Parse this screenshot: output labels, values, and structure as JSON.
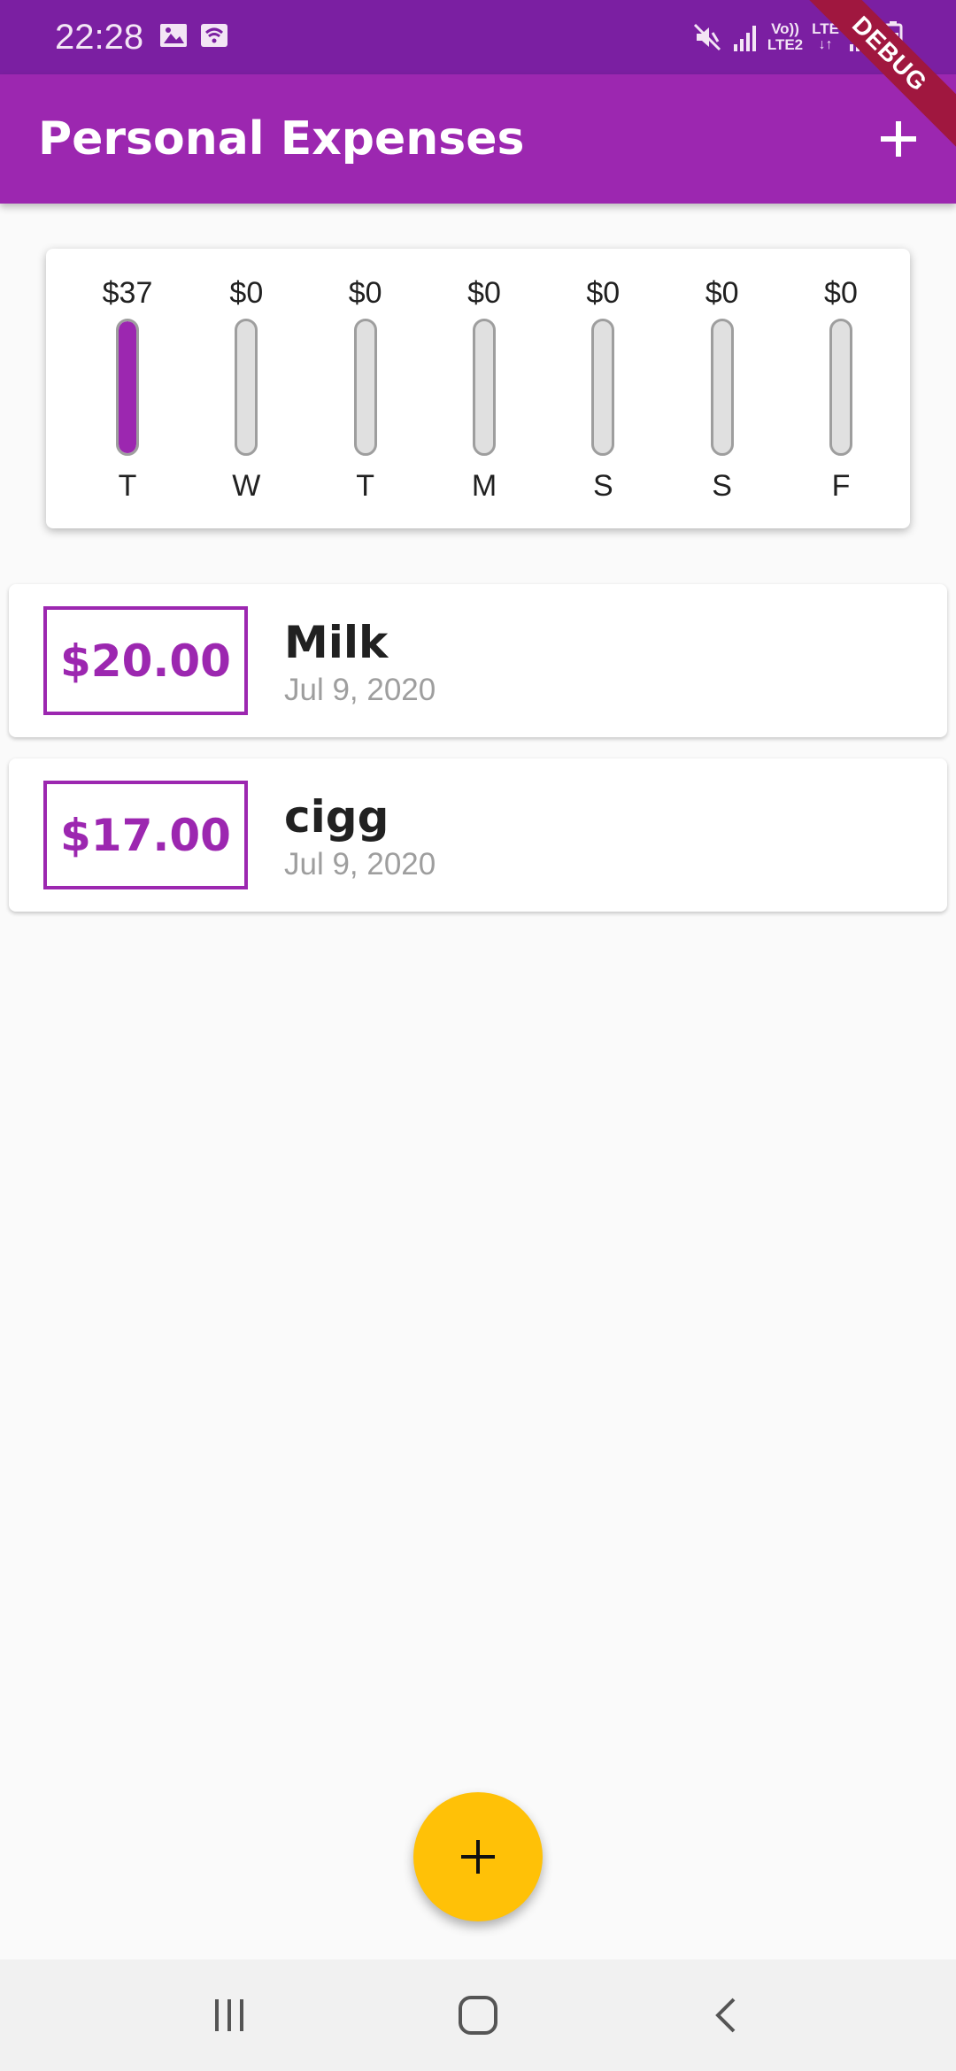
{
  "status_bar": {
    "time": "22:28",
    "icons_left": [
      "image-icon",
      "wifi-icon"
    ],
    "icons_right": [
      "mute-icon",
      "signal-icon",
      "volte-icon",
      "lte-icon",
      "signal-icon",
      "battery-icon"
    ],
    "volte_line1": "Vo))",
    "volte_line2": "LTE2",
    "lte_label": "LTE"
  },
  "debug_banner": "DEBUG",
  "app_bar": {
    "title": "Personal Expenses",
    "add_icon": "plus-icon"
  },
  "chart": {
    "colors": {
      "fill": "#9c27b0",
      "empty": "#e0e0e0"
    },
    "days": [
      {
        "day": "T",
        "amount": "$37",
        "fill_fraction": 1.0
      },
      {
        "day": "W",
        "amount": "$0",
        "fill_fraction": 0
      },
      {
        "day": "T",
        "amount": "$0",
        "fill_fraction": 0
      },
      {
        "day": "M",
        "amount": "$0",
        "fill_fraction": 0
      },
      {
        "day": "S",
        "amount": "$0",
        "fill_fraction": 0
      },
      {
        "day": "S",
        "amount": "$0",
        "fill_fraction": 0
      },
      {
        "day": "F",
        "amount": "$0",
        "fill_fraction": 0
      }
    ]
  },
  "transactions": [
    {
      "amount": "$20.00",
      "title": "Milk",
      "date": "Jul 9, 2020"
    },
    {
      "amount": "$17.00",
      "title": "cigg",
      "date": "Jul 9, 2020"
    }
  ],
  "fab": {
    "icon": "plus-icon",
    "color": "#ffc107"
  },
  "nav_bar": {
    "buttons": [
      "recent-apps-icon",
      "home-icon",
      "back-icon"
    ]
  },
  "theme": {
    "primary": "#9c27b0",
    "status_bar": "#7b1fa2",
    "accent": "#ffc107"
  }
}
